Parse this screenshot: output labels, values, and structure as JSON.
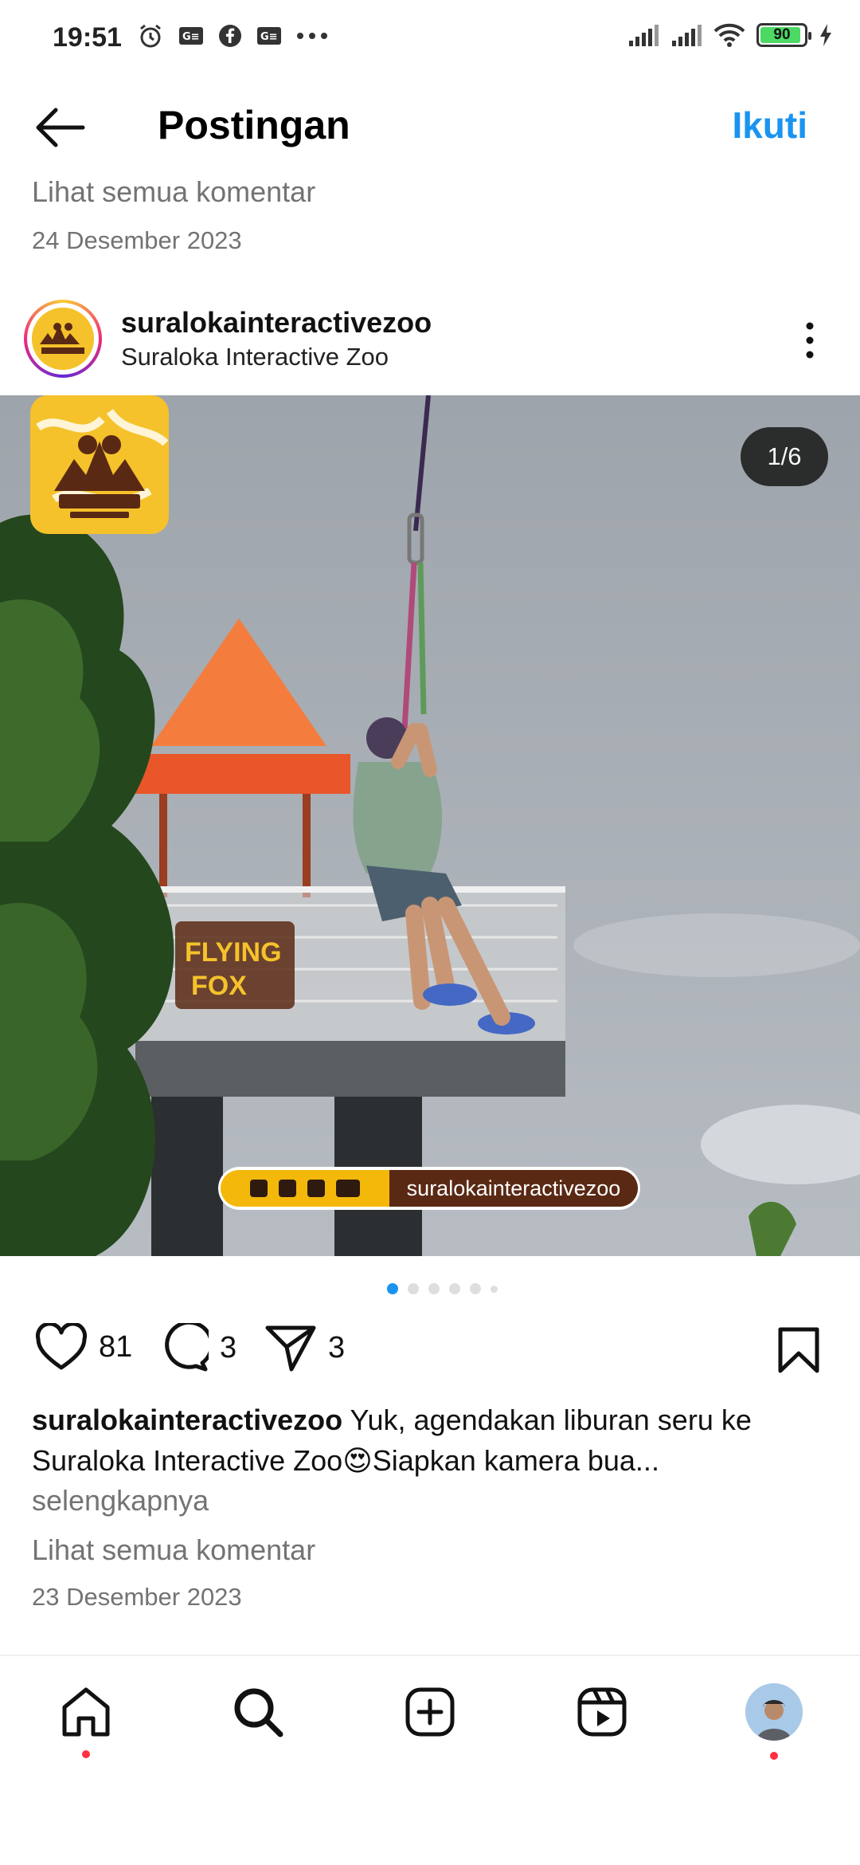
{
  "status_bar": {
    "time": "19:51",
    "battery": "90",
    "icons_left": [
      "alarm-icon",
      "gmail-icon",
      "facebook-icon",
      "gmail-icon",
      "more-dots-icon"
    ],
    "icons_right": [
      "signal-icon",
      "signal-icon",
      "wifi-icon",
      "battery-icon",
      "charging-icon"
    ]
  },
  "header": {
    "title": "Postingan",
    "follow_label": "Ikuti"
  },
  "previous_post": {
    "view_comments": "Lihat semua komentar",
    "date": "24 Desember 2023"
  },
  "post": {
    "username": "suralokainteractivezoo",
    "display_name": "Suraloka Interactive Zoo",
    "image_counter": "1/6",
    "image_overlay": {
      "social_handle": "suralokainteractivezoo",
      "booth_sign": "FLYING FOX"
    },
    "carousel": {
      "total": 6,
      "active_index": 0
    },
    "likes": "81",
    "comments": "3",
    "shares": "3",
    "caption_user": "suralokainteractivezoo",
    "caption_text": " Yuk, agendakan liburan seru ke Suraloka Interactive Zoo😍Siapkan kamera bua...",
    "more_label": "selengkapnya",
    "view_comments": "Lihat semua komentar",
    "date": "23 Desember 2023"
  },
  "colors": {
    "accent": "#1a94f0",
    "muted_text": "#737373",
    "notification_dot": "#ff3040",
    "brand_yellow": "#f3b80a",
    "brand_brown": "#5a2914"
  },
  "bottom_nav": [
    "home-icon",
    "search-icon",
    "create-icon",
    "reels-icon",
    "profile-avatar"
  ]
}
